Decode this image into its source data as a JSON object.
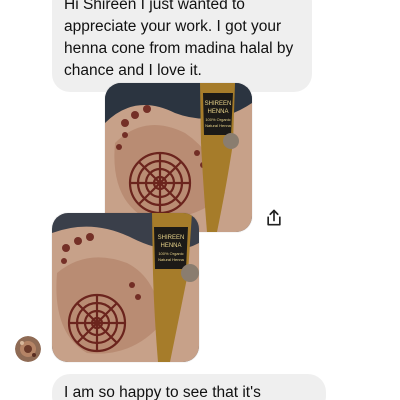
{
  "messages": {
    "top_text": "Hi Shireen I just wanted to\nappreciate your work. I got your\nhenna cone from madina halal by\nchance and I love it.",
    "bottom_text": "I am so happy to see that it's"
  },
  "photos": [
    {
      "name": "henna-hand-photo-1",
      "label_lines": [
        "SHIREEN",
        "HENNA",
        "100% Organic",
        "Natural Henna"
      ]
    },
    {
      "name": "henna-hand-photo-2",
      "label_lines": [
        "SHIREEN",
        "HENNA",
        "100% Organic",
        "Natural Henna"
      ]
    }
  ],
  "colors": {
    "bubble_bg": "#efefef",
    "text": "#111111",
    "henna": "#7a2a22",
    "skin": "#c9a58f",
    "label_bg": "#1c1a17",
    "cone_gold": "#a67c2a"
  },
  "icons": {
    "share": "share-icon",
    "avatar": "avatar"
  }
}
